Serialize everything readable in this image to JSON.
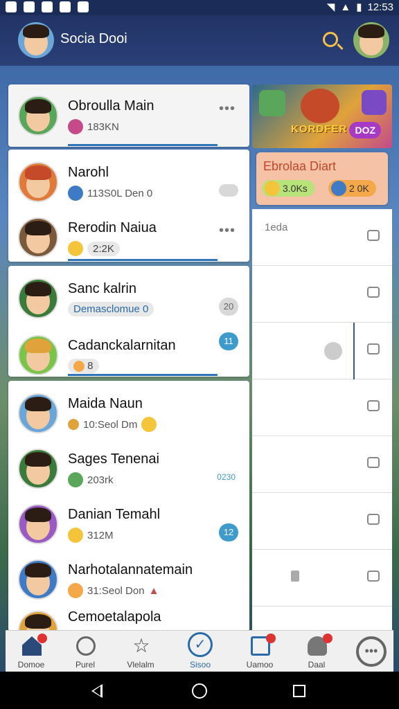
{
  "status_bar": {
    "time": "12:53"
  },
  "app_bar": {
    "title": "Socia Dooi"
  },
  "chats": [
    {
      "name": "Obroulla Main",
      "meta": "183KN",
      "badge": ""
    },
    {
      "name": "Narohl",
      "meta": "113S0L Den 0",
      "badge": ""
    },
    {
      "name": "Rerodin Naiua",
      "meta": "2:2K",
      "badge": ""
    },
    {
      "name": "Sanc kalrin",
      "meta": "Demasclomue 0",
      "badge": "20"
    },
    {
      "name": "Cadanckalarnitan",
      "meta": "8",
      "badge": "11"
    },
    {
      "name": "Maida Naun",
      "meta": "10:Seol Dm",
      "badge": ""
    },
    {
      "name": "Sages Tenenai",
      "meta": "203rk",
      "badge": "0230"
    },
    {
      "name": "Danian Temahl",
      "meta": "312M",
      "badge": "12"
    },
    {
      "name": "Narhotalannatemain",
      "meta": "31:Seol Don",
      "badge": ""
    },
    {
      "name": "Cemoetalapola",
      "meta": "",
      "badge": ""
    }
  ],
  "promo": {
    "title": "KORDFER",
    "discount": "DOZ"
  },
  "offer": {
    "title": "Ebrolaa Diart",
    "chip1": "3.0Ks",
    "chip2": "2 0K"
  },
  "threads": [
    {
      "text": "1eda"
    }
  ],
  "bottom_nav": [
    {
      "label": "Domoe"
    },
    {
      "label": "Purel"
    },
    {
      "label": "Vlelalm"
    },
    {
      "label": "Sisoo"
    },
    {
      "label": "Uamoo"
    },
    {
      "label": "Daal"
    }
  ],
  "colors": {
    "accent": "#2f74b6",
    "appbar": "#223466",
    "badge": "#3f9bcc"
  }
}
